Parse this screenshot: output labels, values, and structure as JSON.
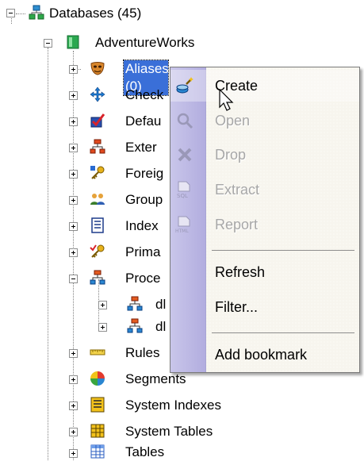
{
  "tree": {
    "root": {
      "label": "Databases (45)",
      "expanded": true
    },
    "database": {
      "label": "AdventureWorks",
      "expanded": true
    },
    "items": [
      {
        "label": "Aliases (0)",
        "icon": "aliases-mask-icon",
        "selected": true
      },
      {
        "label": "Check",
        "icon": "check-arrows-icon"
      },
      {
        "label": "Defau",
        "icon": "defaults-check-icon"
      },
      {
        "label": "Exter",
        "icon": "external-hierarchy-icon"
      },
      {
        "label": "Foreig",
        "icon": "foreign-key-icon"
      },
      {
        "label": "Group",
        "icon": "groups-icon"
      },
      {
        "label": "Index",
        "icon": "indexes-icon"
      },
      {
        "label": "Prima",
        "icon": "primary-key-icon"
      },
      {
        "label": "Proce",
        "icon": "procedures-icon",
        "expanded": true
      },
      {
        "label": "dl",
        "icon": "procedure-icon",
        "child": true
      },
      {
        "label": "dl",
        "icon": "procedure-icon",
        "child": true
      },
      {
        "label": "Rules",
        "icon": "rules-ruler-icon"
      },
      {
        "label": "Segments",
        "icon": "segments-icon"
      },
      {
        "label": "System Indexes",
        "icon": "system-indexes-icon"
      },
      {
        "label": "System Tables",
        "icon": "system-tables-icon"
      },
      {
        "label": "Tables",
        "icon": "tables-icon"
      }
    ]
  },
  "context_menu": {
    "items": [
      {
        "label": "Create",
        "icon": "create-wand-icon",
        "enabled": true,
        "hover": true
      },
      {
        "label": "Open",
        "icon": "open-magnifier-icon",
        "enabled": false
      },
      {
        "label": "Drop",
        "icon": "drop-x-icon",
        "enabled": false
      },
      {
        "label": "Extract",
        "icon": "extract-sql-icon",
        "enabled": false
      },
      {
        "label": "Report",
        "icon": "report-html-icon",
        "enabled": false
      },
      {
        "separator": true
      },
      {
        "label": "Refresh",
        "enabled": true
      },
      {
        "label": "Filter...",
        "enabled": true
      },
      {
        "separator": true
      },
      {
        "label": "Add bookmark",
        "enabled": true
      }
    ]
  }
}
